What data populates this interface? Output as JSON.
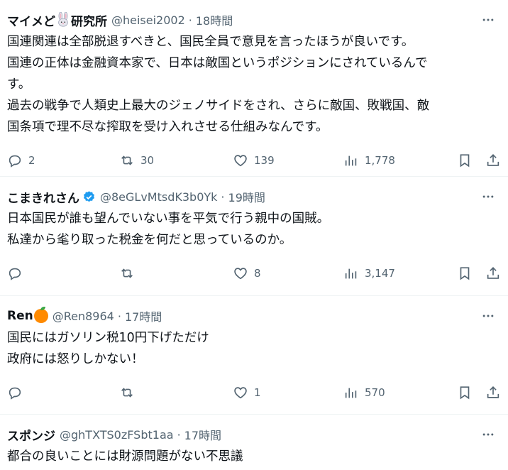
{
  "posts": [
    {
      "name": "マイメど",
      "name_suffix": "研究所",
      "handle": "@heisei2002",
      "dot": "·",
      "time": "18時間",
      "lines": [
        "国連関連は全部脱退すべきと、国民全員で意見を言ったほうが良いです。",
        "国連の正体は金融資本家で、日本は敵国というポジションにされているんで",
        "す。",
        "過去の戦争で人類史上最大のジェノサイドをされ、さらに敵国、敗戦国、敵",
        "国条項で理不尽な搾取を受け入れさせる仕組みなんです。"
      ],
      "replies": "2",
      "reposts": "30",
      "likes": "139",
      "views": "1,778"
    },
    {
      "name": "こまきれさん",
      "handle": "@8eGLvMtsdK3b0Yk",
      "dot": "·",
      "time": "19時間",
      "lines": [
        "日本国民が誰も望んでいない事を平気で行う親中の国賊。",
        "私達から毟り取った税金を何だと思っているのか。"
      ],
      "replies": "",
      "reposts": "",
      "likes": "8",
      "views": "3,147"
    },
    {
      "name": "Ren",
      "handle": "@Ren8964",
      "dot": "·",
      "time": "17時間",
      "lines": [
        "国民にはガソリン税10円下げただけ",
        "政府には怒りしかない！"
      ],
      "replies": "",
      "reposts": "",
      "likes": "1",
      "views": "570"
    },
    {
      "name": "スポンジ",
      "handle": "@ghTXTS0zFSbt1aa",
      "dot": "·",
      "time": "17時間",
      "lines": [
        "都合の良いことには財源問題がない不思議"
      ]
    }
  ],
  "colors": {
    "text": "#0f1419",
    "muted": "#536471",
    "verified": "#1d9bf0",
    "divider": "#eff3f4"
  },
  "icons": {
    "more": "more-icon",
    "reply": "reply-icon",
    "repost": "repost-icon",
    "like": "heart-icon",
    "views": "views-icon",
    "bookmark": "bookmark-icon",
    "share": "share-icon"
  }
}
